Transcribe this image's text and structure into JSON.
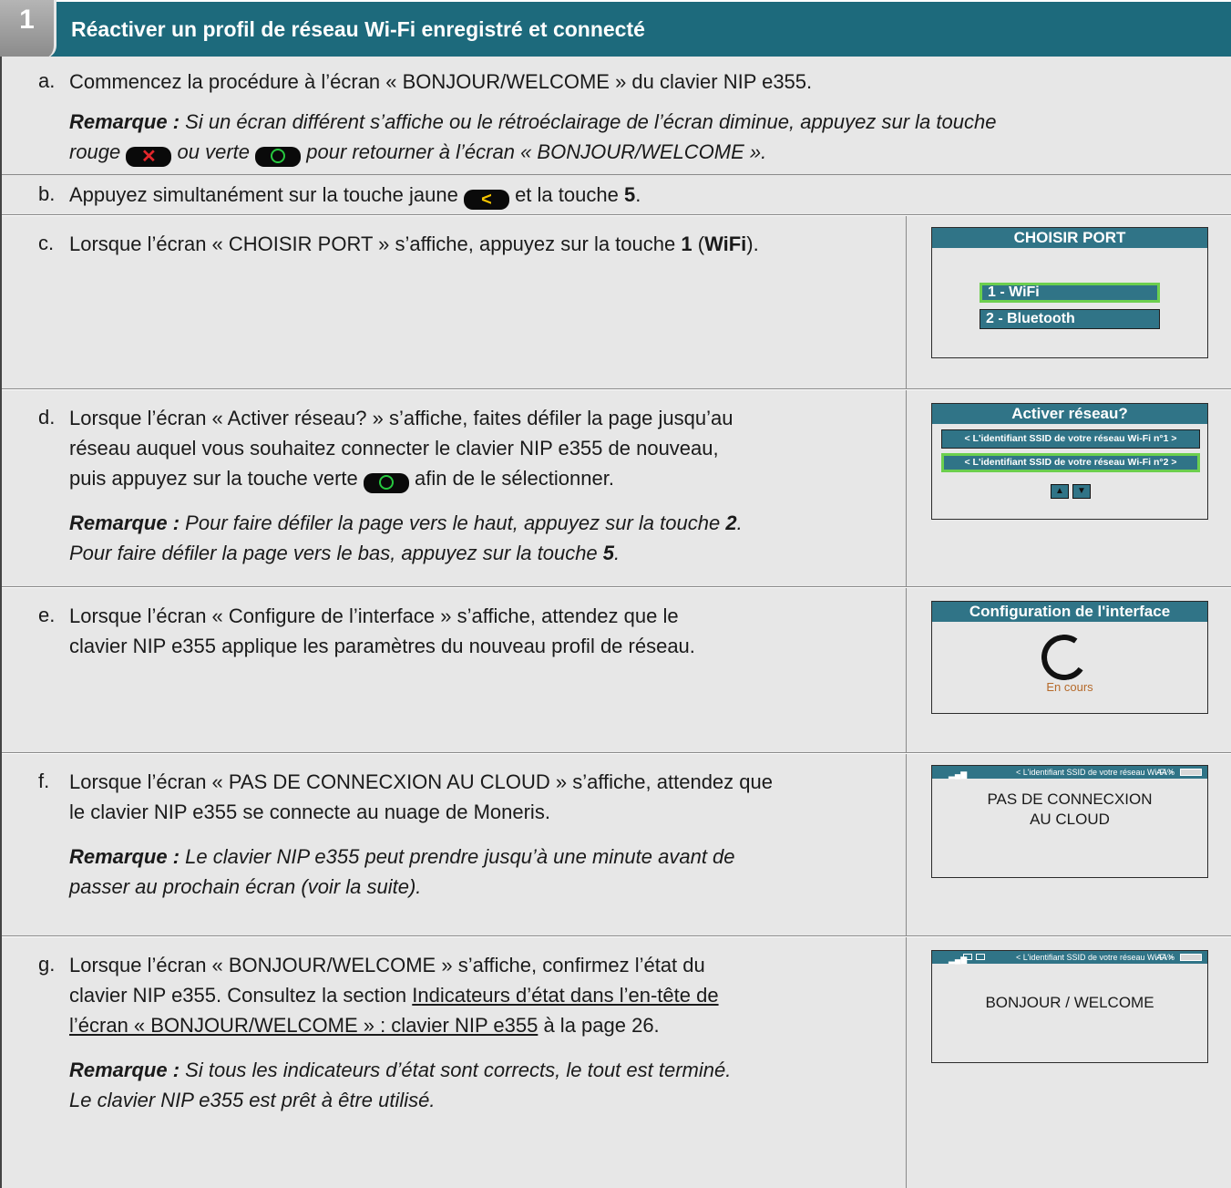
{
  "header": {
    "step_number": "1",
    "title": "Réactiver un profil de réseau Wi-Fi enregistré et connecté"
  },
  "steps": {
    "a": {
      "letter": "a.",
      "text": "Commencez la procédure à l’écran « BONJOUR/WELCOME » du clavier NIP e355.",
      "note_label": "Remarque :",
      "note_1": "Si un écran différent s’affiche ou le rétroéclairage de l’écran diminue, appuyez sur la touche",
      "note_2a": "rouge",
      "note_2b": "ou verte",
      "note_2c": "pour retourner à l’écran « BONJOUR/WELCOME »."
    },
    "b": {
      "letter": "b.",
      "text_1": "Appuyez simultanément sur la touche jaune",
      "text_2": "et la touche",
      "key": "5",
      "end": "."
    },
    "c": {
      "letter": "c.",
      "text_1": "Lorsque l’écran « CHOISIR PORT » s’affiche, appuyez sur la touche",
      "key": "1",
      "paren_open": "(",
      "key_label": "WiFi",
      "paren_close": ")."
    },
    "d": {
      "letter": "d.",
      "line_1": "Lorsque l’écran « Activer réseau? » s’affiche, faites défiler la page jusqu’au",
      "line_2": "réseau auquel vous souhaitez connecter le clavier NIP e355 de nouveau,",
      "line_3a": "puis appuyez sur la touche verte",
      "line_3b": "afin de le sélectionner.",
      "note_label": "Remarque :",
      "note_1": "Pour faire défiler la page vers le haut, appuyez sur la touche",
      "note_key_1": "2",
      "note_2": "Pour faire défiler la page vers le bas, appuyez sur la touche",
      "note_key_2": "5"
    },
    "e": {
      "letter": "e.",
      "line_1": "Lorsque l’écran « Configure de l’interface » s’affiche, attendez que le",
      "line_2": "clavier NIP e355 applique les paramètres du nouveau profil de réseau."
    },
    "f": {
      "letter": "f.",
      "line_1": "Lorsque l’écran « PAS DE CONNECXION AU CLOUD » s’affiche, attendez que",
      "line_2": "le clavier NIP e355 se connecte au nuage de Moneris.",
      "note_label": "Remarque :",
      "note_1": "Le clavier NIP e355 peut prendre jusqu’à une minute avant de",
      "note_2": "passer au prochain écran (voir la suite)."
    },
    "g": {
      "letter": "g.",
      "line_1": "Lorsque l’écran « BONJOUR/WELCOME » s’affiche, confirmez l’état du",
      "line_2a": "clavier NIP e355. Consultez la section",
      "link_1": "Indicateurs d’état dans l’en-tête de",
      "link_2": "l’écran « BONJOUR/WELCOME » : clavier NIP e355",
      "line_3b": "à la page 26.",
      "note_label": "Remarque :",
      "note_1": "Si tous les indicateurs d’état sont corrects, le tout est terminé.",
      "note_2": "Le clavier NIP e355 est prêt à être utilisé."
    }
  },
  "keys": {
    "cancel": "✕",
    "yellow": "<"
  },
  "screens": {
    "choisir": {
      "title": "CHOISIR PORT",
      "opt_1": "1 - WiFi",
      "opt_2": "2 - Bluetooth"
    },
    "activer": {
      "title": "Activer réseau?",
      "ssid_1": "< L'identifiant SSID de votre réseau Wi-Fi n°1 >",
      "ssid_2": "< L'identifiant SSID de votre réseau Wi-Fi n°2 >"
    },
    "config": {
      "title": "Configuration de l'interface",
      "status": "En cours"
    },
    "cloud": {
      "status_ssid": "< L'identifiant SSID de votre réseau Wi-Fi >",
      "status_pct": "AA%",
      "line_1": "PAS DE CONNECXION",
      "line_2": "AU CLOUD"
    },
    "welcome": {
      "status_ssid": "< L'identifiant SSID de votre réseau Wi-Fi >",
      "status_pct": "AA%",
      "message": "BONJOUR / WELCOME"
    }
  },
  "colors": {
    "header": "#1d6a7c",
    "screen_bar": "#307487",
    "row_bg": "#e7e7e7",
    "key_red": "#e3262b",
    "key_green": "#27c93f",
    "key_yellow": "#f5c400",
    "selection": "#6ccf4e"
  }
}
